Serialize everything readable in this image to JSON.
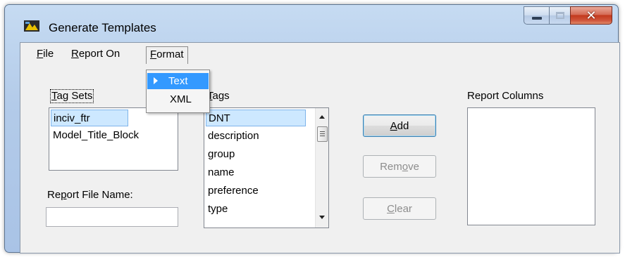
{
  "window": {
    "title": "Generate Templates"
  },
  "menubar": {
    "items": [
      {
        "label": "File",
        "mnemonic": "F",
        "rest": "ile"
      },
      {
        "label": "Report On",
        "mnemonic": "R",
        "rest": "eport On"
      },
      {
        "label": "Format",
        "mnemonic": "F",
        "rest": "ormat"
      }
    ]
  },
  "format_menu": {
    "items": [
      {
        "label": "Text",
        "checked": true,
        "highlighted": true
      },
      {
        "label": "XML",
        "checked": false,
        "highlighted": false
      }
    ]
  },
  "tag_sets": {
    "label_mnemonic": "T",
    "label_rest": "ag Sets",
    "items": [
      "inciv_ftr",
      "Model_Title_Block"
    ],
    "selected_index": 0
  },
  "tags": {
    "label_mnemonic": "T",
    "label_rest": "ags",
    "items": [
      "DNT",
      "description",
      "group",
      "name",
      "preference",
      "type"
    ],
    "selected_index": 0
  },
  "report_columns": {
    "label": "Report Columns",
    "items": []
  },
  "report_file_name": {
    "label_pre": "Re",
    "label_mnemonic": "p",
    "label_post": "ort File Name:",
    "value": ""
  },
  "buttons": {
    "add": {
      "mnemonic": "A",
      "rest": "dd",
      "enabled": true
    },
    "remove": {
      "pre": "Rem",
      "mnemonic": "o",
      "post": "ve",
      "enabled": false
    },
    "clear": {
      "mnemonic": "C",
      "rest": "lear",
      "enabled": false
    }
  },
  "colors": {
    "menu_highlight": "#3399ff",
    "selection_bg": "#cde8ff",
    "close_button": "#c2391d"
  }
}
